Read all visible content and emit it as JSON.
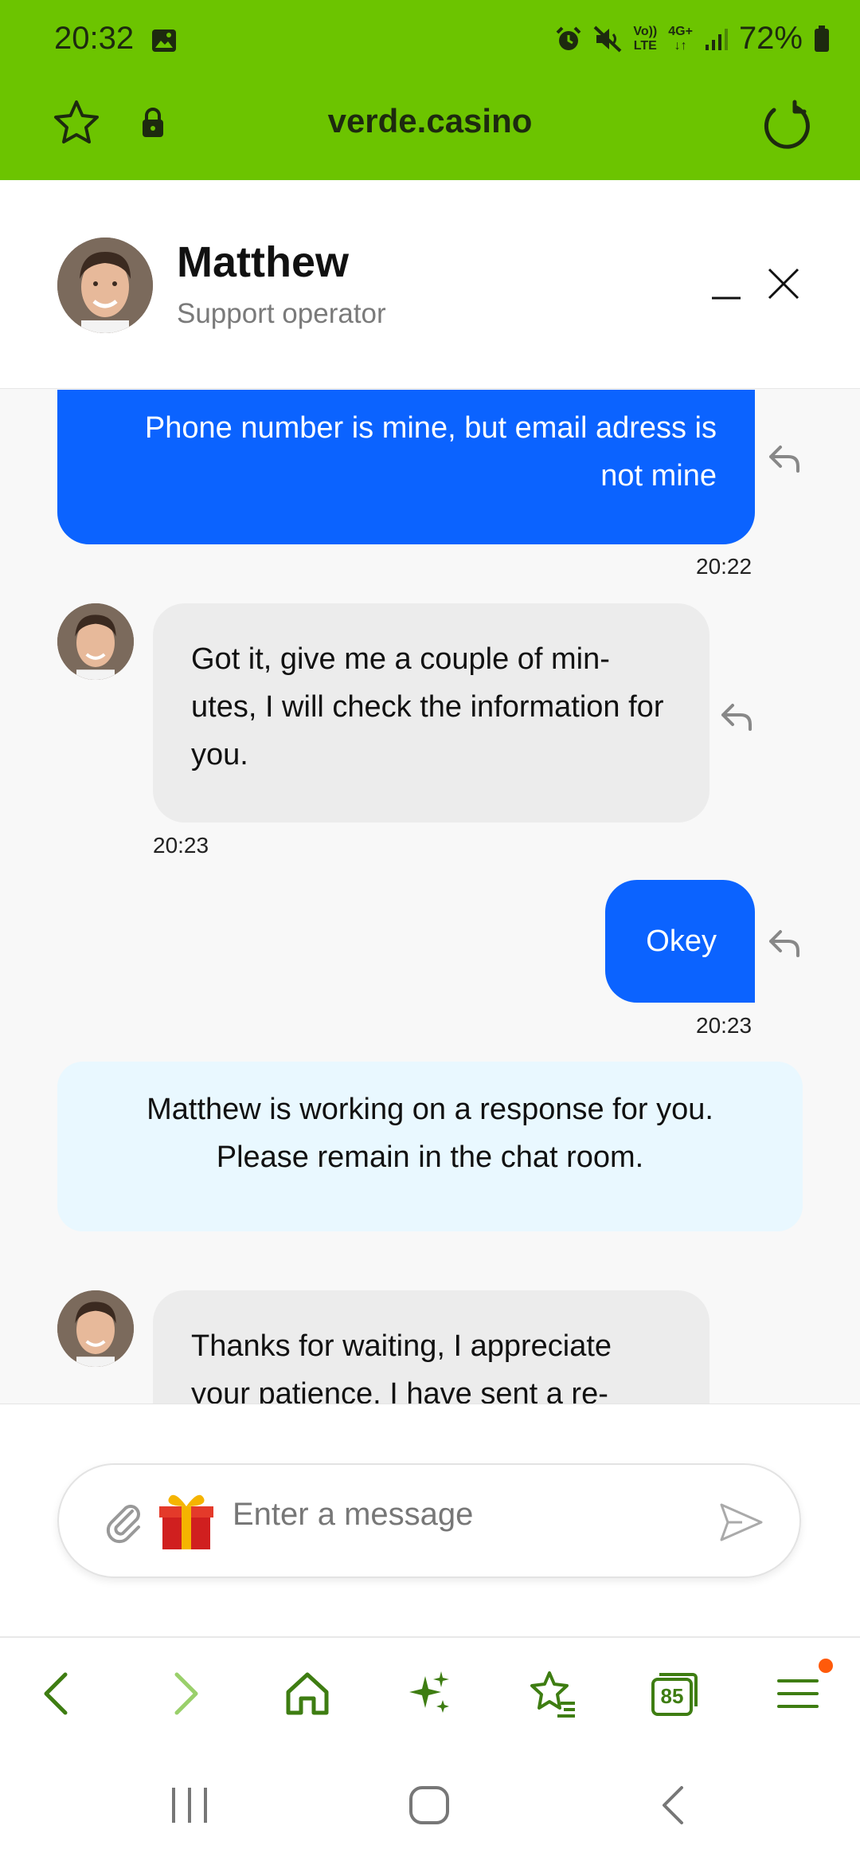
{
  "status_bar": {
    "time": "20:32",
    "battery": "72%",
    "volte_label_top": "Vo))",
    "volte_label_bottom": "LTE",
    "network_label": "4G+"
  },
  "browser": {
    "url": "verde.casino"
  },
  "chat": {
    "operator_name": "Matthew",
    "operator_role": "Support operator",
    "messages": [
      {
        "from": "user",
        "text": "Phone number is mine, but email adress is not mine",
        "time": "20:22"
      },
      {
        "from": "operator",
        "text": "Got it, give me a couple of min-utes, I will check the information for you.",
        "time": "20:23"
      },
      {
        "from": "user",
        "text": "Okey",
        "time": "20:23"
      },
      {
        "from": "system",
        "text": "Matthew is working on a response for you. Please remain in the chat room."
      },
      {
        "from": "operator",
        "text": "Thanks for waiting, I appreciate your patience. I have sent a re-"
      }
    ],
    "input_placeholder": "Enter a message"
  },
  "bottom_bar": {
    "tabs_count": "85"
  },
  "colors": {
    "brand_green": "#6cc400",
    "user_bubble": "#0b63ff",
    "operator_bubble": "#ececec",
    "system_bubble": "#e9f8ff",
    "icon_green": "#3e7d12"
  }
}
